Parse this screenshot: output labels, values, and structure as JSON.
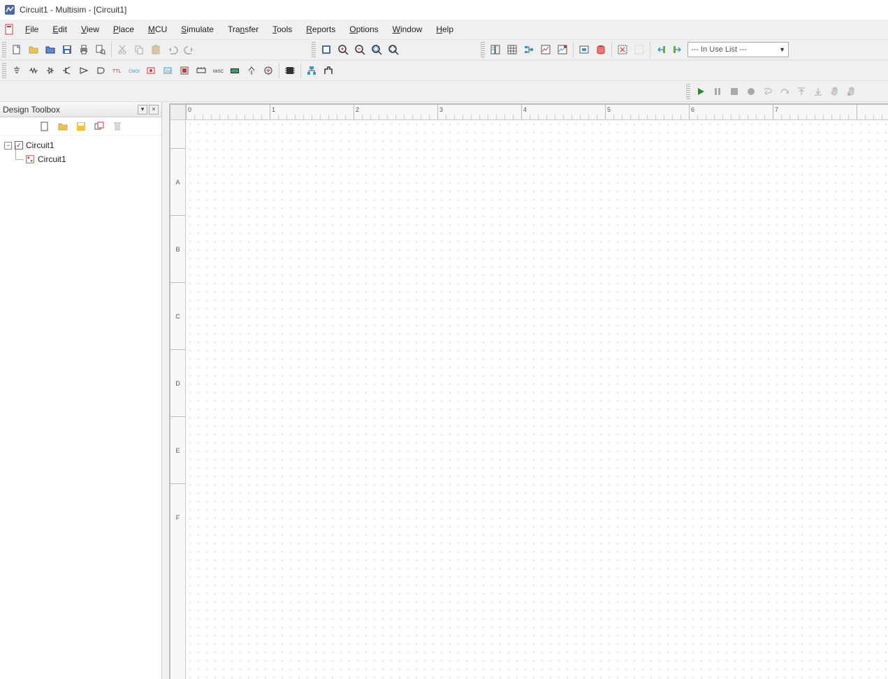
{
  "title": "Circuit1 - Multisim - [Circuit1]",
  "menu": {
    "items": [
      "File",
      "Edit",
      "View",
      "Place",
      "MCU",
      "Simulate",
      "Transfer",
      "Tools",
      "Reports",
      "Options",
      "Window",
      "Help"
    ]
  },
  "toolbar1": {
    "icons": [
      "new-file",
      "open-file",
      "open-example",
      "save",
      "print",
      "print-preview",
      "cut",
      "copy",
      "paste",
      "undo",
      "redo"
    ],
    "enabled": [
      true,
      true,
      true,
      true,
      true,
      true,
      false,
      false,
      false,
      false,
      false
    ]
  },
  "toolbar1b": {
    "icons": [
      "zoom-area",
      "zoom-in",
      "zoom-out",
      "zoom-fit",
      "zoom-full"
    ]
  },
  "toolbar1c": {
    "icons": [
      "design-toolbox",
      "spreadsheet",
      "netlist",
      "grapher",
      "postprocessor",
      "component-wizard",
      "database",
      "electrical-rules",
      "clear-erc",
      "back-annotate",
      "forward-annotate"
    ],
    "dropdown": "--- In Use List ---"
  },
  "toolbar2": {
    "icons": [
      "source",
      "basic",
      "diode",
      "transistor",
      "analog",
      "ttl",
      "cmos",
      "misc-digital",
      "mixed",
      "indicator",
      "power",
      "misc",
      "advanced",
      "rf",
      "electromech",
      "nist",
      "mcu-comp",
      "hierarchical",
      "bus"
    ]
  },
  "simbar": {
    "icons": [
      "run",
      "pause",
      "stop",
      "record",
      "step-into",
      "step-over",
      "step-out",
      "step-back",
      "hand",
      "pan"
    ],
    "enabled": [
      true,
      false,
      false,
      false,
      false,
      false,
      false,
      false,
      false,
      false
    ]
  },
  "sidepanel": {
    "title": "Design Toolbox",
    "toolbar": [
      "new-page",
      "open-page",
      "save-page",
      "rename-page",
      "delete-page"
    ],
    "tree": {
      "root": "Circuit1",
      "child": "Circuit1"
    }
  },
  "ruler": {
    "h": [
      "0",
      "1",
      "2",
      "3",
      "4",
      "5",
      "6",
      "7"
    ],
    "v": [
      "A",
      "B",
      "C",
      "D",
      "E",
      "F"
    ]
  }
}
